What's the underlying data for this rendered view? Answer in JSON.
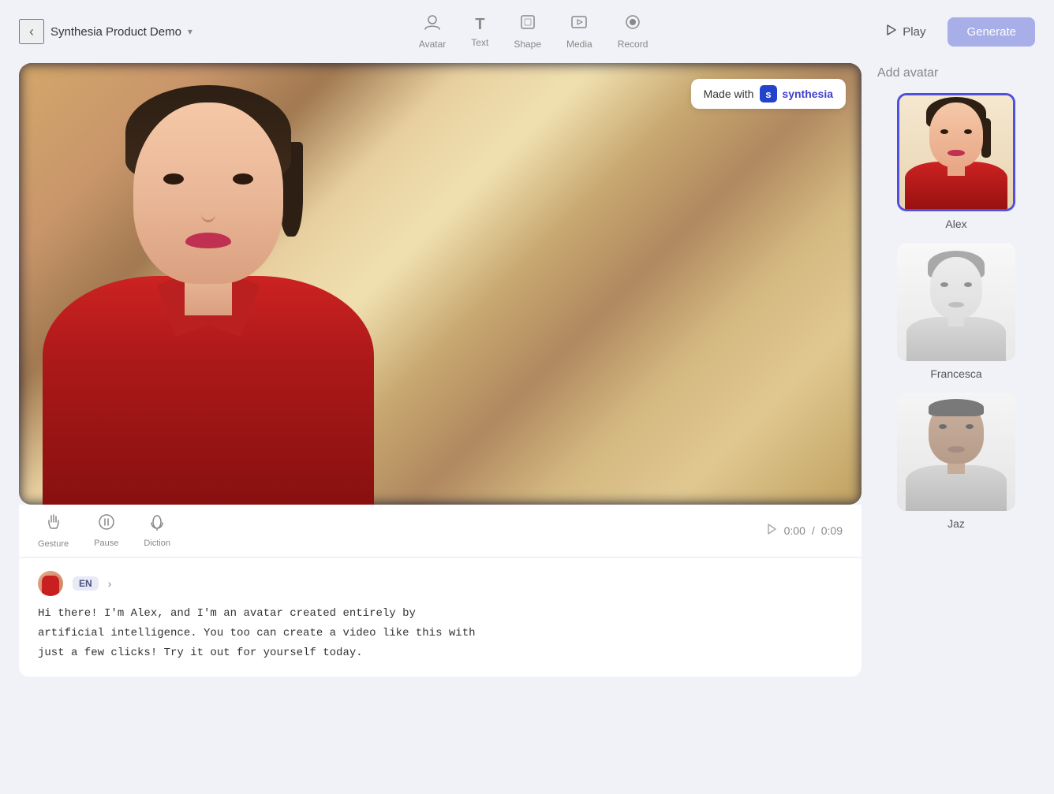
{
  "header": {
    "back_label": "‹",
    "project_name": "Synthesia Product Demo",
    "dropdown_label": "▾",
    "tools": [
      {
        "id": "avatar",
        "label": "Avatar",
        "icon": "👤"
      },
      {
        "id": "text",
        "label": "Text",
        "icon": "T"
      },
      {
        "id": "shape",
        "label": "Shape",
        "icon": "⬡"
      },
      {
        "id": "media",
        "label": "Media",
        "icon": "🖼"
      },
      {
        "id": "record",
        "label": "Record",
        "icon": "⏺"
      }
    ],
    "play_label": "Play",
    "generate_label": "Generate"
  },
  "video": {
    "watermark_prefix": "Made with",
    "watermark_brand": "synthesia",
    "watermark_logo_letter": "s"
  },
  "controls": {
    "gesture_label": "Gesture",
    "pause_label": "Pause",
    "diction_label": "Diction",
    "time_current": "0:00",
    "time_total": "0:09",
    "time_separator": " / "
  },
  "script": {
    "lang": "EN",
    "text": "Hi there! I'm Alex, and I'm an avatar created entirely by\nartificial intelligence. You too can create a video like this with\njust a few clicks! Try it out for yourself today."
  },
  "sidebar": {
    "add_avatar_title": "Add avatar",
    "avatars": [
      {
        "id": "alex",
        "name": "Alex",
        "selected": true
      },
      {
        "id": "francesca",
        "name": "Francesca",
        "selected": false
      },
      {
        "id": "jaz",
        "name": "Jaz",
        "selected": false
      }
    ]
  }
}
